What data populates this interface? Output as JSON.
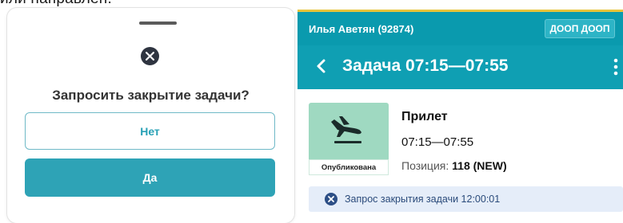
{
  "top_fragment": "или направлен.",
  "dialog": {
    "question": "Запросить закрытие задачи?",
    "no_label": "Нет",
    "yes_label": "Да",
    "accent_color": "#2ea3b6"
  },
  "app": {
    "user_name": "Илья Аветян (92874)",
    "org_badge": "ДООП ДООП",
    "header_title": "Задача 07:15—07:55",
    "brand_color": "#0f9fb3"
  },
  "task": {
    "type": "Прилет",
    "time": "07:15—07:55",
    "position_label": "Позиция:",
    "position_value": "118 (NEW)",
    "status": "Опубликована",
    "icon": "plane-landing-icon",
    "card_color": "#9fd9c1"
  },
  "notice": {
    "text": "Запрос закрытия задачи 12:00:01",
    "icon": "close-circle-icon"
  }
}
